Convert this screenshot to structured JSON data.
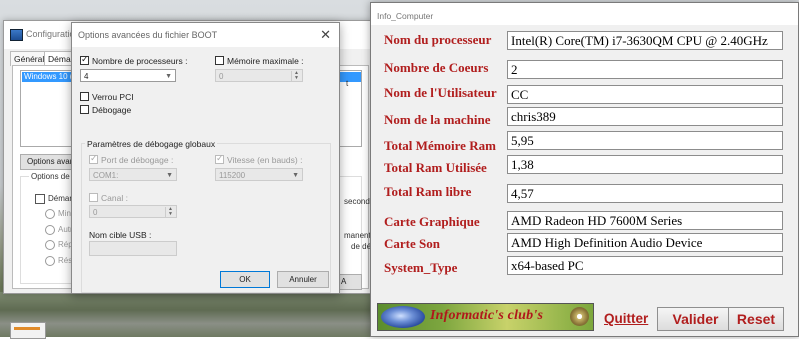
{
  "config_window": {
    "title": "Configuration",
    "tabs": [
      "Général",
      "Démarr"
    ],
    "list_selected": "Windows 10 (C",
    "options_button": "Options avan",
    "group_title": "Options de dé",
    "boot_check": "Démarrag",
    "radio_items": [
      "Minima",
      "Autre",
      "Répar",
      "Résea"
    ],
    "right_fragments": [
      "t",
      "secondes",
      "manente",
      "de démar"
    ],
    "footer_button": "A"
  },
  "boot_options": {
    "title": "Options avancées du fichier BOOT",
    "close_icon": "✕",
    "nb_processors": {
      "label": "Nombre de processeurs :",
      "checked": true,
      "value": "4"
    },
    "max_memory": {
      "label": "Mémoire maximale :",
      "checked": false,
      "value": "0"
    },
    "pci_lock": {
      "label": "Verrou PCI",
      "checked": false
    },
    "debug": {
      "label": "Débogage",
      "checked": false
    },
    "global_debug_title": "Paramètres de débogage globaux",
    "debug_port": {
      "label": "Port de débogage :",
      "checked": true,
      "value": "COM1:"
    },
    "baud_rate": {
      "label": "Vitesse (en bauds) :",
      "checked": true,
      "value": "115200"
    },
    "channel": {
      "label": "Canal :",
      "checked": false,
      "value": "0"
    },
    "usb_target": {
      "label": "Nom cible USB :",
      "value": ""
    },
    "ok_label": "OK",
    "cancel_label": "Annuler"
  },
  "info_computer": {
    "title": "Info_Computer",
    "rows": [
      {
        "label": "Nom du processeur",
        "value": "Intel(R) Core(TM) i7-3630QM CPU @ 2.40GHz"
      },
      {
        "label": "Nombre de Coeurs",
        "value": "2"
      },
      {
        "label": "Nom de l'Utilisateur",
        "value": "CC"
      },
      {
        "label": "Nom de la machine",
        "value": "chris389"
      },
      {
        "label": "Total Mémoire Ram",
        "value": "5,95"
      },
      {
        "label": "Total Ram Utilisée",
        "value": "1,38"
      },
      {
        "label": "Total Ram libre",
        "value": "4,57"
      },
      {
        "label": "Carte Graphique",
        "value": "AMD Radeon HD 7600M Series"
      },
      {
        "label": "Carte Son",
        "value": "AMD High Definition Audio Device"
      },
      {
        "label": "System_Type",
        "value": "x64-based PC"
      }
    ],
    "banner_text": "Informatic's club's",
    "quit_label": "Quitter",
    "validate_label": "Valider",
    "reset_label": "Reset"
  }
}
